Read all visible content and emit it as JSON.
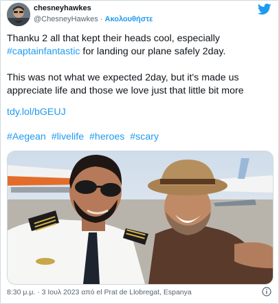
{
  "author": {
    "display_name": "chesneyhawkes",
    "handle": "@ChesneyHawkes",
    "separator": "·",
    "follow_label": "Ακολουθήστε"
  },
  "tweet": {
    "line1_text": "Thanku 2 all that kept their heads cool, especially",
    "line2_hashtag": "#captainfantastic",
    "line2_text": " for landing our plane safely 2day.",
    "paragraph2": "This was not what we expected 2day, but it's made us appreciate life and those we love just that little bit more",
    "link": "tdy.lol/bGEUJ",
    "hashtags": [
      "#Aegean",
      "#livelife",
      "#heroes",
      "#scary"
    ]
  },
  "footer": {
    "timestamp": "8:30 μ.μ. · 3 Ιουλ 2023 από el Prat de Llobregat, Espanya"
  },
  "icons": {
    "brand": "twitter-bird-icon",
    "info": "info-icon"
  },
  "colors": {
    "link": "#1d9bf0",
    "text": "#0f1419",
    "muted": "#536471",
    "border": "#cfd9de"
  }
}
